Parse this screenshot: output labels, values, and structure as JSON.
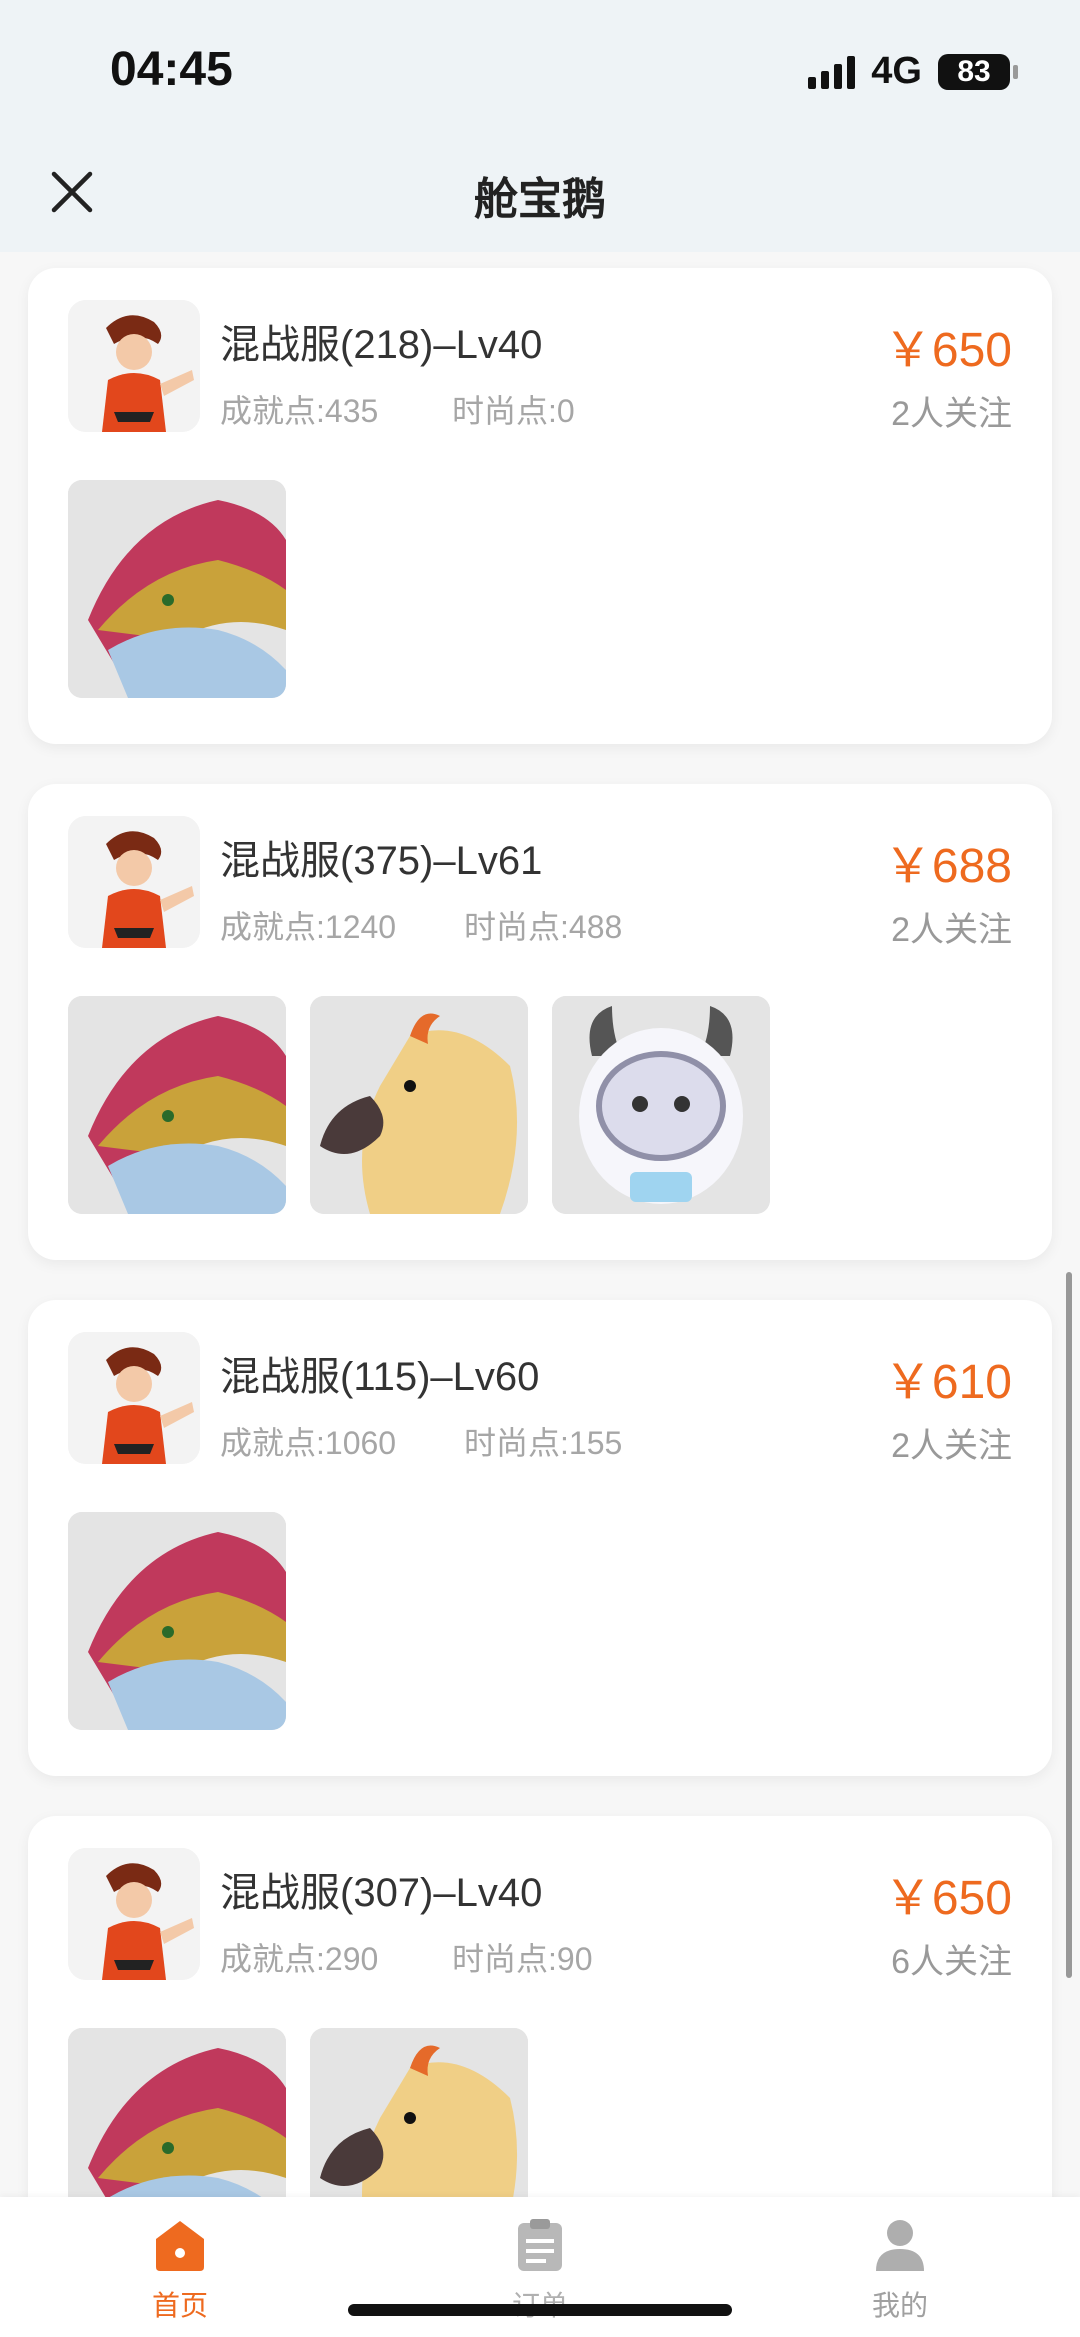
{
  "status": {
    "time": "04:45",
    "network": "4G",
    "battery": "83"
  },
  "header": {
    "title": "舱宝鹅"
  },
  "listings": [
    {
      "title": "混战服(218)–Lv40",
      "achievement": "成就点:435",
      "fashion": "时尚点:0",
      "price": "￥650",
      "followers": "2人关注",
      "thumbs": [
        "dragon"
      ]
    },
    {
      "title": "混战服(375)–Lv61",
      "achievement": "成就点:1240",
      "fashion": "时尚点:488",
      "price": "￥688",
      "followers": "2人关注",
      "thumbs": [
        "dragon",
        "phoenix",
        "robot"
      ]
    },
    {
      "title": "混战服(115)–Lv60",
      "achievement": "成就点:1060",
      "fashion": "时尚点:155",
      "price": "￥610",
      "followers": "2人关注",
      "thumbs": [
        "dragon"
      ]
    },
    {
      "title": "混战服(307)–Lv40",
      "achievement": "成就点:290",
      "fashion": "时尚点:90",
      "price": "￥650",
      "followers": "6人关注",
      "thumbs": [
        "dragon",
        "phoenix"
      ]
    }
  ],
  "nav": {
    "home": "首页",
    "orders": "订单",
    "mine": "我的"
  },
  "colors": {
    "accent": "#ee6a1f",
    "background": "#eef3f6"
  }
}
